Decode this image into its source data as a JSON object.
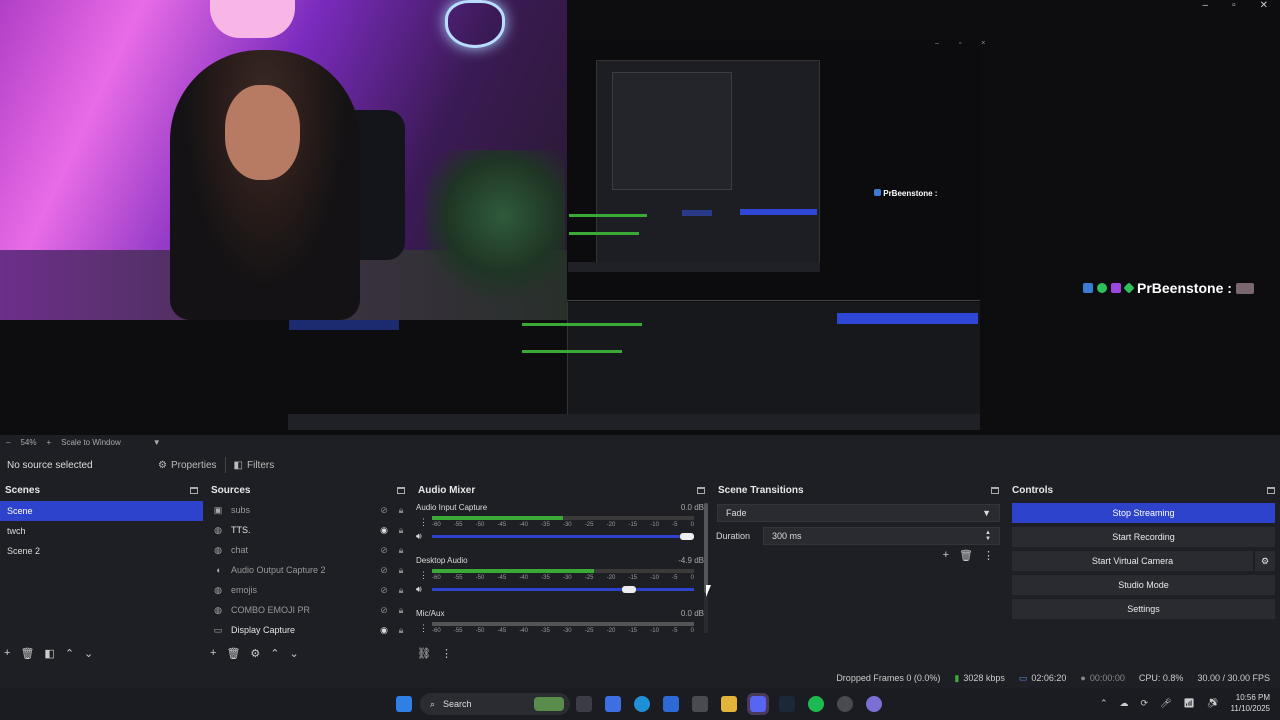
{
  "preview": {
    "chat_name_big": "PrBeenstone :",
    "chat_name_small": "PrBeenstone :",
    "mini_win_controls": "– ▫ ×",
    "window_controls": [
      "–",
      "▫",
      "✕"
    ]
  },
  "zoom_row": {
    "zoom": "54%",
    "scale_mode": "Scale to Window"
  },
  "source_toolbar": {
    "no_source": "No source selected",
    "properties": "Properties",
    "filters": "Filters"
  },
  "scenes": {
    "title": "Scenes",
    "items": [
      {
        "label": "Scene",
        "selected": true
      },
      {
        "label": "twch",
        "selected": false
      },
      {
        "label": "Scene 2",
        "selected": false
      }
    ]
  },
  "sources": {
    "title": "Sources",
    "items": [
      {
        "label": "subs",
        "icon": "image-icon",
        "visible": false
      },
      {
        "label": "TTS.",
        "icon": "globe-icon",
        "visible": true
      },
      {
        "label": "chat",
        "icon": "globe-icon",
        "visible": false
      },
      {
        "label": "Audio Output Capture 2",
        "icon": "speaker-icon",
        "visible": false
      },
      {
        "label": "emojis",
        "icon": "globe-icon",
        "visible": false
      },
      {
        "label": "COMBO EMOJI PR",
        "icon": "globe-icon",
        "visible": false
      },
      {
        "label": "Display Capture",
        "icon": "monitor-icon",
        "visible": true
      }
    ]
  },
  "mixer": {
    "title": "Audio Mixer",
    "scale": [
      "-60",
      "-55",
      "-50",
      "-45",
      "-40",
      "-35",
      "-30",
      "-25",
      "-20",
      "-15",
      "-10",
      "-5",
      "0"
    ],
    "channels": [
      {
        "name": "Audio Input Capture",
        "db": "0.0 dB",
        "level": 0.5,
        "volume": 1.0
      },
      {
        "name": "Desktop Audio",
        "db": "-4.9 dB",
        "level": 0.62,
        "volume": 0.78
      },
      {
        "name": "Mic/Aux",
        "db": "0.0 dB",
        "level": 0.0,
        "volume": 1.0
      }
    ]
  },
  "transitions": {
    "title": "Scene Transitions",
    "selected": "Fade",
    "duration_label": "Duration",
    "duration_value": "300 ms"
  },
  "controls": {
    "title": "Controls",
    "buttons": [
      "Stop Streaming",
      "Start Recording",
      "Start Virtual Camera",
      "Studio Mode",
      "Settings"
    ]
  },
  "status": {
    "dropped": "Dropped Frames 0 (0.0%)",
    "bitrate": "3028 kbps",
    "stream_time": "02:06:20",
    "rec_time": "00:00:00",
    "cpu": "CPU: 0.8%",
    "fps": "30.00 / 30.00 FPS"
  },
  "taskbar": {
    "search": "Search",
    "time": "10:56 PM",
    "date": "11/10/2025"
  },
  "colors": {
    "accent": "#2e43cc",
    "meter_green": "#3aa935",
    "meter_yellow": "#c7a226",
    "meter_red": "#b8242b"
  }
}
